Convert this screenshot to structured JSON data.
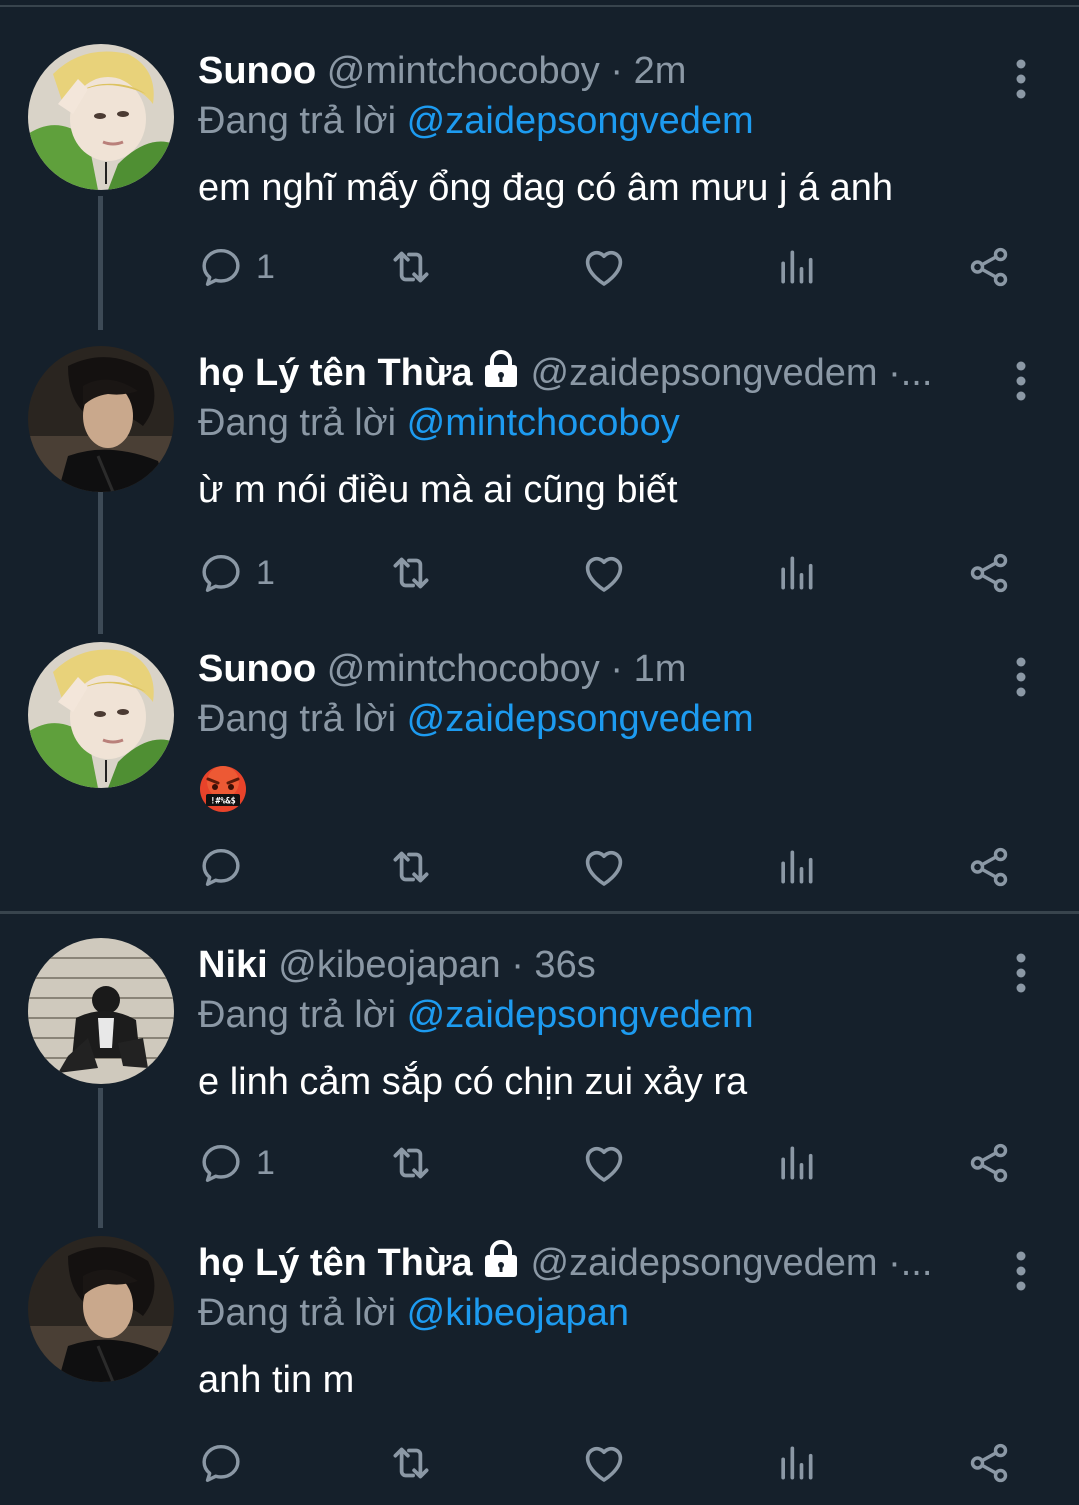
{
  "colors": {
    "background": "#15202b",
    "name": "#ffffff",
    "handle": "#8b98a5",
    "mention": "#1d9bf0",
    "icon": "#8b98a5",
    "divider": "#38444d"
  },
  "tweets": [
    {
      "display_name": "Sunoo",
      "handle_meta": "@mintchocoboy · 2m",
      "reply_prefix": "Đang trả lời",
      "reply_to": "@zaidepsongvedem",
      "text": "em nghĩ mấy ổng đag có âm mưu j á anh",
      "reply_count": "1",
      "protected": false,
      "avatar": "sunoo-avatar"
    },
    {
      "display_name": "họ Lý tên Thừa",
      "handle_meta": "@zaidepsongvedem ·...",
      "reply_prefix": "Đang trả lời",
      "reply_to": "@mintchocoboy",
      "text": "ừ m nói điều mà ai cũng biết",
      "reply_count": "1",
      "protected": true,
      "avatar": "thua-avatar"
    },
    {
      "display_name": "Sunoo",
      "handle_meta": "@mintchocoboy · 1m",
      "reply_prefix": "Đang trả lời",
      "reply_to": "@zaidepsongvedem",
      "text": "",
      "emoji": "face-with-symbols-on-mouth",
      "reply_count": "",
      "protected": false,
      "avatar": "sunoo-avatar"
    },
    {
      "display_name": "Niki",
      "handle_meta": "@kibeojapan · 36s",
      "reply_prefix": "Đang trả lời",
      "reply_to": "@zaidepsongvedem",
      "text": "e linh cảm sắp có chịn zui xảy ra",
      "reply_count": "1",
      "protected": false,
      "avatar": "niki-avatar"
    },
    {
      "display_name": "họ Lý tên Thừa",
      "handle_meta": "@zaidepsongvedem ·...",
      "reply_prefix": "Đang trả lời",
      "reply_to": "@kibeojapan",
      "text": "anh tin m",
      "reply_count": "",
      "protected": true,
      "avatar": "thua-avatar"
    }
  ],
  "icons": {
    "reply": "reply-icon",
    "retweet": "retweet-icon",
    "like": "heart-icon",
    "views": "views-icon",
    "share": "share-icon",
    "more": "more-vertical-icon",
    "lock": "lock-icon"
  }
}
